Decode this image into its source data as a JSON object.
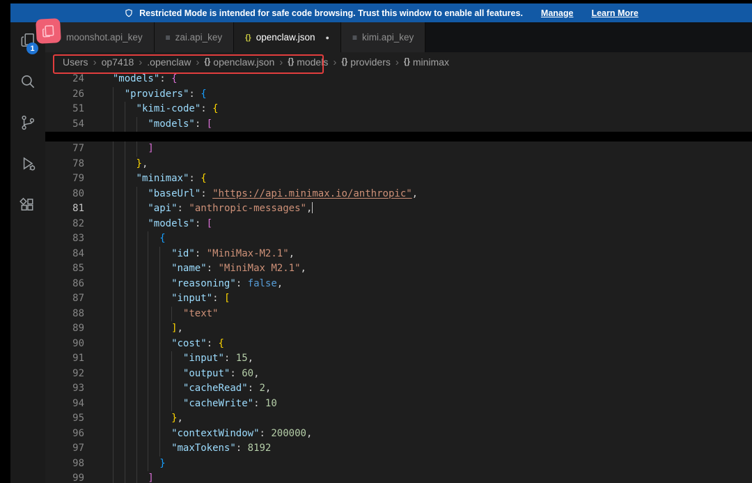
{
  "colors": {
    "banner_bg": "#1259a5",
    "annotation_red": "#e23d3d",
    "sticker_pink": "#ef5f73",
    "badge_blue": "#1f74d4",
    "editor_bg": "#1e1e1e"
  },
  "banner": {
    "text": "Restricted Mode is intended for safe code browsing. Trust this window to enable all features.",
    "manage_label": "Manage",
    "learn_more_label": "Learn More"
  },
  "activity_bar": {
    "badge_count": "1",
    "items": [
      "explorer",
      "search",
      "source-control",
      "run-debug",
      "extensions"
    ]
  },
  "tabs": [
    {
      "label": "moonshot.api_key",
      "icon": "list-icon",
      "active": false,
      "modified": false
    },
    {
      "label": "zai.api_key",
      "icon": "list-icon",
      "active": false,
      "modified": false
    },
    {
      "label": "openclaw.json",
      "icon": "json-braces-icon",
      "active": true,
      "modified": true
    },
    {
      "label": "kimi.api_key",
      "icon": "list-icon",
      "active": false,
      "modified": false
    }
  ],
  "breadcrumb": [
    {
      "label": "Users",
      "icon": null
    },
    {
      "label": "op7418",
      "icon": null
    },
    {
      "label": ".openclaw",
      "icon": null
    },
    {
      "label": "openclaw.json",
      "icon": "{}"
    },
    {
      "label": "models",
      "icon": "{}"
    },
    {
      "label": "providers",
      "icon": "{}"
    },
    {
      "label": "minimax",
      "icon": "{}"
    }
  ],
  "editor": {
    "sticky_lines": [
      {
        "n": "24",
        "i": 1,
        "t": [
          [
            "key",
            "\"models\""
          ],
          [
            "pun",
            ": "
          ],
          [
            "b2",
            "{"
          ]
        ]
      },
      {
        "n": "26",
        "i": 2,
        "t": [
          [
            "key",
            "\"providers\""
          ],
          [
            "pun",
            ": "
          ],
          [
            "b3",
            "{"
          ]
        ]
      },
      {
        "n": "51",
        "i": 3,
        "t": [
          [
            "key",
            "\"kimi-code\""
          ],
          [
            "pun",
            ": "
          ],
          [
            "b1",
            "{"
          ]
        ]
      },
      {
        "n": "54",
        "i": 4,
        "t": [
          [
            "key",
            "\"models\""
          ],
          [
            "pun",
            ": "
          ],
          [
            "b2",
            "["
          ]
        ]
      }
    ],
    "lines": [
      {
        "n": "77",
        "i": 4,
        "t": [
          [
            "b2",
            "]"
          ]
        ]
      },
      {
        "n": "78",
        "i": 3,
        "t": [
          [
            "b1",
            "}"
          ],
          [
            "pun",
            ","
          ]
        ]
      },
      {
        "n": "79",
        "i": 3,
        "t": [
          [
            "key",
            "\"minimax\""
          ],
          [
            "pun",
            ": "
          ],
          [
            "b1",
            "{"
          ]
        ]
      },
      {
        "n": "80",
        "i": 4,
        "t": [
          [
            "key",
            "\"baseUrl\""
          ],
          [
            "pun",
            ": "
          ],
          [
            "link",
            "\"https://api.minimax.io/anthropic\""
          ],
          [
            "pun",
            ","
          ]
        ]
      },
      {
        "n": "81",
        "i": 4,
        "cur": true,
        "t": [
          [
            "key",
            "\"api\""
          ],
          [
            "pun",
            ": "
          ],
          [
            "str",
            "\"anthropic-messages\""
          ],
          [
            "pun",
            ","
          ],
          [
            "cursor",
            ""
          ]
        ]
      },
      {
        "n": "82",
        "i": 4,
        "t": [
          [
            "key",
            "\"models\""
          ],
          [
            "pun",
            ": "
          ],
          [
            "b2",
            "["
          ]
        ]
      },
      {
        "n": "83",
        "i": 5,
        "t": [
          [
            "b3",
            "{"
          ]
        ]
      },
      {
        "n": "84",
        "i": 6,
        "t": [
          [
            "key",
            "\"id\""
          ],
          [
            "pun",
            ": "
          ],
          [
            "str",
            "\"MiniMax-M2.1\""
          ],
          [
            "pun",
            ","
          ]
        ]
      },
      {
        "n": "85",
        "i": 6,
        "t": [
          [
            "key",
            "\"name\""
          ],
          [
            "pun",
            ": "
          ],
          [
            "str",
            "\"MiniMax M2.1\""
          ],
          [
            "pun",
            ","
          ]
        ]
      },
      {
        "n": "86",
        "i": 6,
        "t": [
          [
            "key",
            "\"reasoning\""
          ],
          [
            "pun",
            ": "
          ],
          [
            "kw",
            "false"
          ],
          [
            "pun",
            ","
          ]
        ]
      },
      {
        "n": "87",
        "i": 6,
        "t": [
          [
            "key",
            "\"input\""
          ],
          [
            "pun",
            ": "
          ],
          [
            "b1",
            "["
          ]
        ]
      },
      {
        "n": "88",
        "i": 7,
        "t": [
          [
            "str",
            "\"text\""
          ]
        ]
      },
      {
        "n": "89",
        "i": 6,
        "t": [
          [
            "b1",
            "]"
          ],
          [
            "pun",
            ","
          ]
        ]
      },
      {
        "n": "90",
        "i": 6,
        "t": [
          [
            "key",
            "\"cost\""
          ],
          [
            "pun",
            ": "
          ],
          [
            "b1",
            "{"
          ]
        ]
      },
      {
        "n": "91",
        "i": 7,
        "t": [
          [
            "key",
            "\"input\""
          ],
          [
            "pun",
            ": "
          ],
          [
            "num",
            "15"
          ],
          [
            "pun",
            ","
          ]
        ]
      },
      {
        "n": "92",
        "i": 7,
        "t": [
          [
            "key",
            "\"output\""
          ],
          [
            "pun",
            ": "
          ],
          [
            "num",
            "60"
          ],
          [
            "pun",
            ","
          ]
        ]
      },
      {
        "n": "93",
        "i": 7,
        "t": [
          [
            "key",
            "\"cacheRead\""
          ],
          [
            "pun",
            ": "
          ],
          [
            "num",
            "2"
          ],
          [
            "pun",
            ","
          ]
        ]
      },
      {
        "n": "94",
        "i": 7,
        "t": [
          [
            "key",
            "\"cacheWrite\""
          ],
          [
            "pun",
            ": "
          ],
          [
            "num",
            "10"
          ]
        ]
      },
      {
        "n": "95",
        "i": 6,
        "t": [
          [
            "b1",
            "}"
          ],
          [
            "pun",
            ","
          ]
        ]
      },
      {
        "n": "96",
        "i": 6,
        "t": [
          [
            "key",
            "\"contextWindow\""
          ],
          [
            "pun",
            ": "
          ],
          [
            "num",
            "200000"
          ],
          [
            "pun",
            ","
          ]
        ]
      },
      {
        "n": "97",
        "i": 6,
        "t": [
          [
            "key",
            "\"maxTokens\""
          ],
          [
            "pun",
            ": "
          ],
          [
            "num",
            "8192"
          ]
        ]
      },
      {
        "n": "98",
        "i": 5,
        "t": [
          [
            "b3",
            "}"
          ]
        ]
      },
      {
        "n": "99",
        "i": 4,
        "t": [
          [
            "b2",
            "]"
          ]
        ]
      }
    ]
  }
}
